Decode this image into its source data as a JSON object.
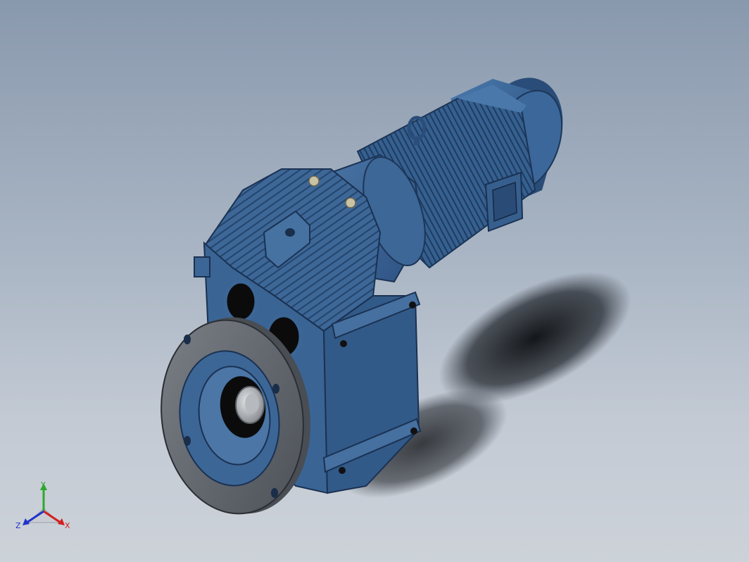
{
  "viewport": {
    "background_top": "#8999ad",
    "background_bottom": "#cdd2d9"
  },
  "model": {
    "body_color": "#3f6a99",
    "body_dark": "#25476f",
    "flange_color": "#5f646b",
    "components": [
      "gear-unit-housing",
      "output-flange",
      "hollow-output-shaft",
      "adapter",
      "electric-motor",
      "terminal-box",
      "fan-cover",
      "lifting-eye"
    ]
  },
  "triad": {
    "x_label": "X",
    "y_label": "Y",
    "z_label": "Z",
    "x_color": "#d21f1f",
    "y_color": "#2fa82f",
    "z_color": "#2034c8"
  }
}
